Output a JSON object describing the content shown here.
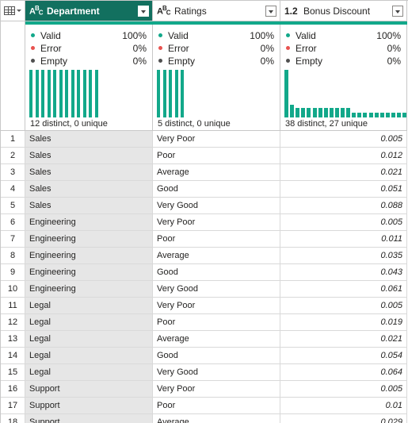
{
  "columns": [
    {
      "type_icon": "ABC",
      "name": "Department",
      "valid": "100%",
      "error": "0%",
      "empty": "0%",
      "stat": "12 distinct, 0 unique",
      "bar_heights": [
        1,
        1,
        1,
        1,
        1,
        1,
        1,
        1,
        1,
        1,
        1,
        1
      ]
    },
    {
      "type_icon": "ABC",
      "name": "Ratings",
      "valid": "100%",
      "error": "0%",
      "empty": "0%",
      "stat": "5 distinct, 0 unique",
      "bar_heights": [
        1,
        1,
        1,
        1,
        1
      ]
    },
    {
      "type_icon": "1.2",
      "name": "Bonus Discount",
      "valid": "100%",
      "error": "0%",
      "empty": "0%",
      "stat": "38 distinct, 27 unique",
      "bar_heights": [
        1,
        0.27,
        0.2,
        0.2,
        0.2,
        0.2,
        0.2,
        0.2,
        0.2,
        0.2,
        0.2,
        0.2,
        0.1,
        0.1,
        0.1,
        0.1,
        0.1,
        0.1,
        0.1,
        0.1,
        0.1,
        0.1,
        0.1
      ]
    }
  ],
  "quality_labels": {
    "valid": "Valid",
    "error": "Error",
    "empty": "Empty"
  },
  "colors": {
    "valid": "#12a88a",
    "error": "#e8524f",
    "empty": "#505050",
    "selected_header": "#12705f",
    "bars": "#12a88a"
  },
  "rows": [
    {
      "n": "1",
      "dep": "Sales",
      "rat": "Very Poor",
      "bon": "0.005"
    },
    {
      "n": "2",
      "dep": "Sales",
      "rat": "Poor",
      "bon": "0.012"
    },
    {
      "n": "3",
      "dep": "Sales",
      "rat": "Average",
      "bon": "0.021"
    },
    {
      "n": "4",
      "dep": "Sales",
      "rat": "Good",
      "bon": "0.051"
    },
    {
      "n": "5",
      "dep": "Sales",
      "rat": "Very Good",
      "bon": "0.088"
    },
    {
      "n": "6",
      "dep": "Engineering",
      "rat": "Very Poor",
      "bon": "0.005"
    },
    {
      "n": "7",
      "dep": "Engineering",
      "rat": "Poor",
      "bon": "0.011"
    },
    {
      "n": "8",
      "dep": "Engineering",
      "rat": "Average",
      "bon": "0.035"
    },
    {
      "n": "9",
      "dep": "Engineering",
      "rat": "Good",
      "bon": "0.043"
    },
    {
      "n": "10",
      "dep": "Engineering",
      "rat": "Very Good",
      "bon": "0.061"
    },
    {
      "n": "11",
      "dep": "Legal",
      "rat": "Very Poor",
      "bon": "0.005"
    },
    {
      "n": "12",
      "dep": "Legal",
      "rat": "Poor",
      "bon": "0.019"
    },
    {
      "n": "13",
      "dep": "Legal",
      "rat": "Average",
      "bon": "0.021"
    },
    {
      "n": "14",
      "dep": "Legal",
      "rat": "Good",
      "bon": "0.054"
    },
    {
      "n": "15",
      "dep": "Legal",
      "rat": "Very Good",
      "bon": "0.064"
    },
    {
      "n": "16",
      "dep": "Support",
      "rat": "Very Poor",
      "bon": "0.005"
    },
    {
      "n": "17",
      "dep": "Support",
      "rat": "Poor",
      "bon": "0.01"
    },
    {
      "n": "18",
      "dep": "Support",
      "rat": "Average",
      "bon": "0.029"
    }
  ]
}
